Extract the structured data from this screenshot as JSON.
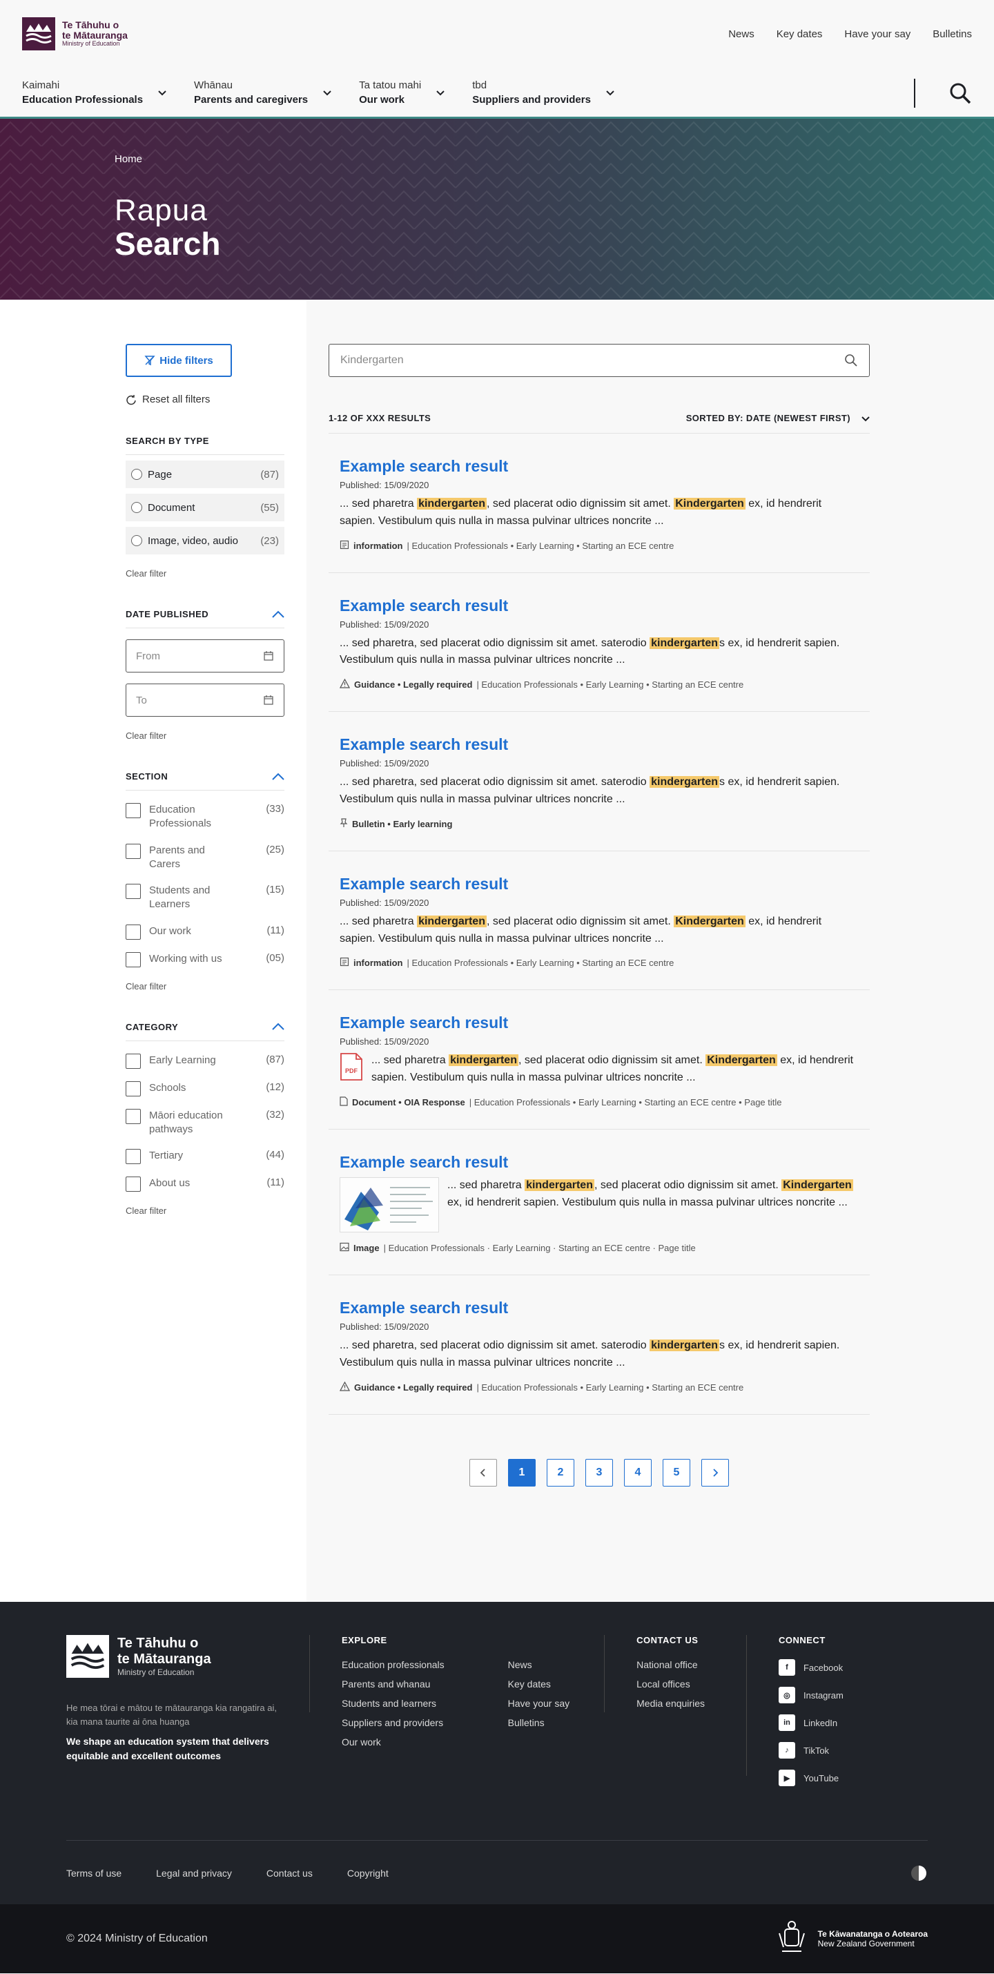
{
  "header": {
    "logo": {
      "line1": "Te Tāhuhu o",
      "line2": "te Mātauranga",
      "line3": "Ministry of Education"
    },
    "utility_nav": [
      "News",
      "Key dates",
      "Have your say",
      "Bulletins"
    ],
    "main_nav": [
      {
        "top": "Kaimahi",
        "bottom": "Education Professionals"
      },
      {
        "top": "Whānau",
        "bottom": "Parents and caregivers"
      },
      {
        "top": "Ta tatou mahi",
        "bottom": "Our work"
      },
      {
        "top": "tbd",
        "bottom": "Suppliers and providers"
      }
    ]
  },
  "hero": {
    "breadcrumb": "Home",
    "subtitle": "Rapua",
    "title": "Search"
  },
  "filters": {
    "hide_label": "Hide filters",
    "reset_label": "Reset all filters",
    "clear_label": "Clear filter",
    "type": {
      "title": "SEARCH BY TYPE",
      "options": [
        {
          "label": "Page",
          "count": "(87)"
        },
        {
          "label": "Document",
          "count": "(55)"
        },
        {
          "label": "Image, video, audio",
          "count": "(23)"
        }
      ]
    },
    "date": {
      "title": "DATE PUBLISHED",
      "from_placeholder": "From",
      "to_placeholder": "To"
    },
    "section": {
      "title": "SECTION",
      "options": [
        {
          "label": "Education Professionals",
          "count": "(33)"
        },
        {
          "label": "Parents and Carers",
          "count": "(25)"
        },
        {
          "label": "Students and Learners",
          "count": "(15)"
        },
        {
          "label": "Our work",
          "count": "(11)"
        },
        {
          "label": "Working with us",
          "count": "(05)"
        }
      ]
    },
    "category": {
      "title": "CATEGORY",
      "options": [
        {
          "label": "Early Learning",
          "count": "(87)"
        },
        {
          "label": "Schools",
          "count": "(12)"
        },
        {
          "label": "Māori education pathways",
          "count": "(32)"
        },
        {
          "label": "Tertiary",
          "count": "(44)"
        },
        {
          "label": "About us",
          "count": "(11)"
        }
      ]
    }
  },
  "search": {
    "placeholder": "Kindergarten",
    "results_count": "1-12 OF XXX RESULTS",
    "sort_label": "SORTED BY:",
    "sort_value": "DATE (NEWEST FIRST)"
  },
  "results": [
    {
      "title": "Example search result",
      "published": "Published: 15/09/2020",
      "snippet": [
        "... sed pharetra ",
        {
          "hl": "kindergarten"
        },
        ", sed placerat odio dignissim sit amet. ",
        {
          "hl": "Kindergarten"
        },
        " ex, id hendrerit sapien. Vestibulum quis nulla in massa pulvinar ultrices noncrite ..."
      ],
      "icon": "info-icon",
      "type": "information",
      "tags": " | Education Professionals • Early Learning • Starting an ECE centre",
      "media": "none"
    },
    {
      "title": "Example search result",
      "published": "Published: 15/09/2020",
      "snippet": [
        "... sed pharetra, sed placerat odio dignissim sit amet. saterodio ",
        {
          "hl": "kindergarten"
        },
        "s ex, id hendrerit sapien. Vestibulum quis nulla in massa pulvinar ultrices noncrite ..."
      ],
      "icon": "warning-icon",
      "type": "Guidance • Legally required",
      "tags": " | Education Professionals • Early Learning • Starting an ECE centre",
      "media": "none"
    },
    {
      "title": "Example search result",
      "published": "Published: 15/09/2020",
      "snippet": [
        "... sed pharetra, sed placerat odio dignissim sit amet. saterodio ",
        {
          "hl": "kindergarten"
        },
        "s ex, id hendrerit sapien. Vestibulum quis nulla in massa pulvinar ultrices noncrite ..."
      ],
      "icon": "pin-icon",
      "type": "Bulletin • Early learning",
      "tags": "",
      "media": "none"
    },
    {
      "title": "Example search result",
      "published": "Published: 15/09/2020",
      "snippet": [
        "... sed pharetra ",
        {
          "hl": "kindergarten"
        },
        ", sed placerat odio dignissim sit amet. ",
        {
          "hl": "Kindergarten"
        },
        " ex, id hendrerit sapien. Vestibulum quis nulla in massa pulvinar ultrices noncrite ..."
      ],
      "icon": "info-icon",
      "type": "information",
      "tags": " | Education Professionals • Early Learning • Starting an ECE centre",
      "media": "none"
    },
    {
      "title": "Example search result",
      "published": "Published: 15/09/2020",
      "snippet": [
        "... sed pharetra ",
        {
          "hl": "kindergarten"
        },
        ", sed placerat odio dignissim sit amet. ",
        {
          "hl": "Kindergarten"
        },
        " ex, id hendrerit sapien. Vestibulum quis nulla in massa pulvinar ultrices noncrite ..."
      ],
      "icon": "document-icon",
      "type": "Document • OIA Response",
      "tags": " | Education Professionals • Early Learning • Starting an ECE centre • Page title",
      "media": "pdf",
      "pdf_label": "PDF"
    },
    {
      "title": "Example search result",
      "published": "",
      "snippet": [
        "... sed pharetra ",
        {
          "hl": "kindergarten"
        },
        ", sed placerat odio dignissim sit amet. ",
        {
          "hl": "Kindergarten"
        },
        " ex, id hendrerit sapien. Vestibulum quis nulla in massa pulvinar ultrices noncrite ..."
      ],
      "icon": "image-icon",
      "type": "Image",
      "tags": " | Education Professionals · Early Learning · Starting an ECE centre · Page title",
      "media": "image"
    },
    {
      "title": "Example search result",
      "published": "Published: 15/09/2020",
      "snippet": [
        "... sed pharetra, sed placerat odio dignissim sit amet. saterodio ",
        {
          "hl": "kindergarten"
        },
        "s ex, id hendrerit sapien. Vestibulum quis nulla in massa pulvinar ultrices noncrite ..."
      ],
      "icon": "warning-icon",
      "type": "Guidance • Legally required",
      "tags": " | Education Professionals • Early Learning • Starting an ECE centre",
      "media": "none"
    }
  ],
  "pagination": {
    "pages": [
      "1",
      "2",
      "3",
      "4",
      "5"
    ],
    "current": "1"
  },
  "footer": {
    "logo": {
      "line1": "Te Tāhuhu o",
      "line2": "te Mātauranga",
      "line3": "Ministry of Education"
    },
    "tagline": "He mea tōrai e mātou te mātauranga kia rangatira ai, kia mana taurite ai ōna huanga",
    "mission": "We shape an education system that delivers equitable and excellent outcomes",
    "explore_title": "EXPLORE",
    "explore_col1": [
      "Education professionals",
      "Parents and whanau",
      "Students and learners",
      "Suppliers and providers",
      "Our work"
    ],
    "explore_col2": [
      "News",
      "Key dates",
      "Have your say",
      "Bulletins"
    ],
    "contact_title": "CONTACT US",
    "contact": [
      "National office",
      "Local offices",
      "Media enquiries"
    ],
    "connect_title": "CONNECT",
    "social": [
      {
        "label": "Facebook",
        "icon": "facebook-icon",
        "glyph": "f"
      },
      {
        "label": "Instagram",
        "icon": "instagram-icon",
        "glyph": "◎"
      },
      {
        "label": "LinkedIn",
        "icon": "linkedin-icon",
        "glyph": "in"
      },
      {
        "label": "TikTok",
        "icon": "tiktok-icon",
        "glyph": "♪"
      },
      {
        "label": "YouTube",
        "icon": "youtube-icon",
        "glyph": "▶"
      }
    ],
    "legal": [
      "Terms of use",
      "Legal and privacy",
      "Contact us",
      "Copyright"
    ],
    "copyright": "© 2024 Ministry of Education",
    "gov_line1": "Te Kāwanatanga o Aotearoa",
    "gov_line2": "New Zealand Government"
  },
  "colors": {
    "brand": "#4b1c3f",
    "accent": "#1f6fd1",
    "teal": "#3e8a86",
    "highlight": "#f5c96b",
    "footer_bg": "#202329"
  }
}
